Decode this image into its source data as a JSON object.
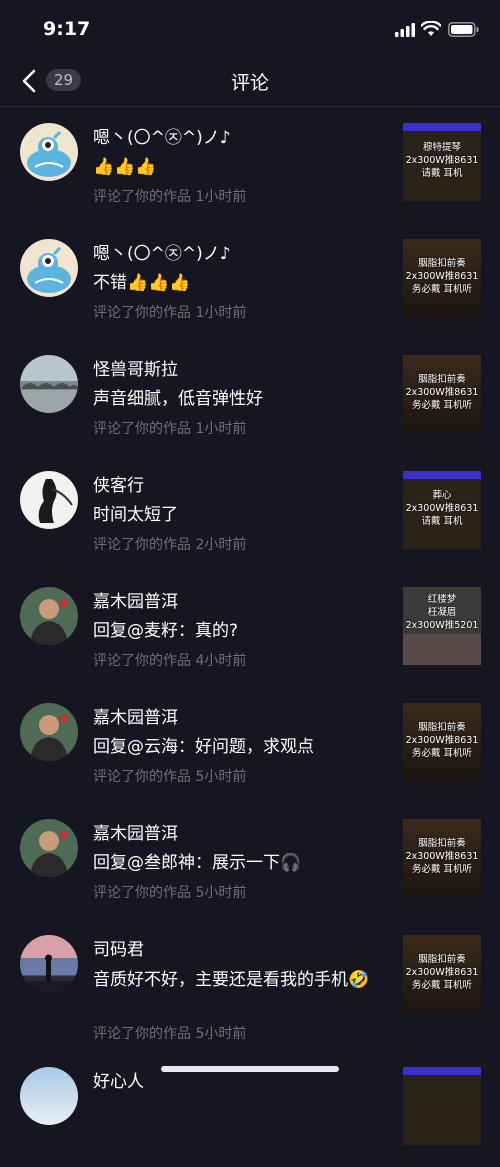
{
  "status": {
    "time": "9:17"
  },
  "nav": {
    "title": "评论",
    "count": "29"
  },
  "items": [
    {
      "name": "嗯丶(〇^㉨^)ノ♪",
      "text": "👍👍👍",
      "meta": "评论了你的作品  1小时前",
      "avatar": "blue-monster",
      "thumb": "穆特提琴\n2x300W推8631\n请戴    耳机"
    },
    {
      "name": "嗯丶(〇^㉨^)ノ♪",
      "text": "不错👍👍👍",
      "meta": "评论了你的作品  1小时前",
      "avatar": "blue-monster",
      "thumb": "胭脂扣前奏\n2x300W推8631\n务必戴    耳机听"
    },
    {
      "name": "怪兽哥斯拉",
      "text": "声音细腻，低音弹性好",
      "meta": "评论了你的作品  1小时前",
      "avatar": "bridge",
      "thumb": "胭脂扣前奏\n2x300W推8631\n务必戴    耳机听"
    },
    {
      "name": "侠客行",
      "text": "时间太短了",
      "meta": "评论了你的作品  2小时前",
      "avatar": "ink",
      "thumb": "葬心\n2x300W推8631\n请戴    耳机"
    },
    {
      "name": "嘉木园普洱",
      "text": "回复@麦籽：真的?",
      "meta": "评论了你的作品  4小时前",
      "avatar": "man",
      "thumb": "红楼梦\n枉凝眉\n2x300W推5201"
    },
    {
      "name": "嘉木园普洱",
      "text": "回复@云海：好问题，求观点",
      "meta": "评论了你的作品  5小时前",
      "avatar": "man",
      "thumb": "胭脂扣前奏\n2x300W推8631\n务必戴    耳机听"
    },
    {
      "name": "嘉木园普洱",
      "text": "回复@叁郎神：展示一下🎧",
      "meta": "评论了你的作品  5小时前",
      "avatar": "man",
      "thumb": "胭脂扣前奏\n2x300W推8631\n务必戴    耳机听"
    },
    {
      "name": "司码君",
      "text": "音质好不好，主要还是看我的手机🤣",
      "meta": "评论了你的作品  5小时前",
      "avatar": "sunset",
      "thumb": "胭脂扣前奏\n2x300W推8631\n务必戴    耳机听"
    },
    {
      "name": "好心人",
      "text": "",
      "meta": "",
      "avatar": "sky",
      "thumb": ""
    }
  ]
}
